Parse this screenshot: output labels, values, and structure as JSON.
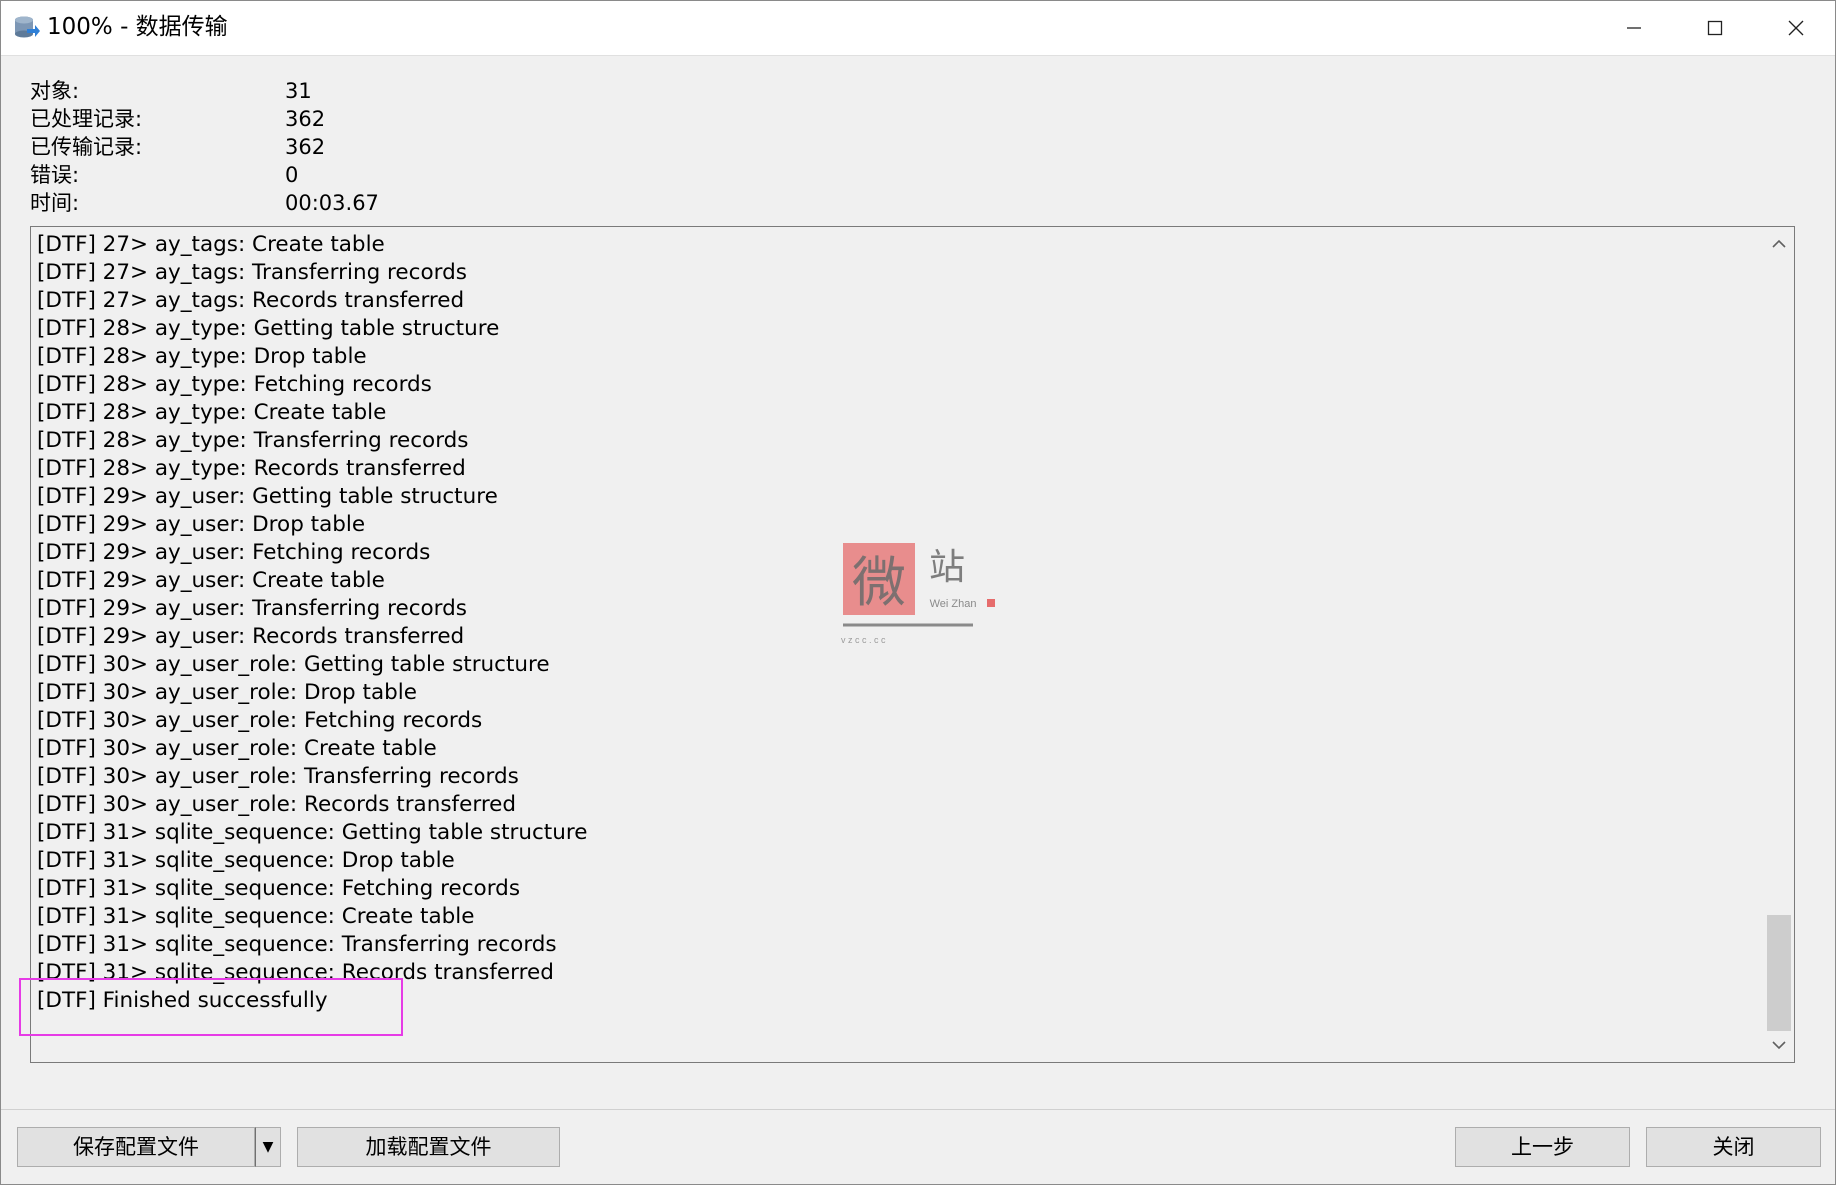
{
  "window": {
    "title": "100% - 数据传输",
    "controls": {
      "minimize": "—",
      "maximize": "☐",
      "close": "✕"
    }
  },
  "summary": [
    {
      "label": "对象:",
      "value": "31"
    },
    {
      "label": "已处理记录:",
      "value": "362"
    },
    {
      "label": "已传输记录:",
      "value": "362"
    },
    {
      "label": "错误:",
      "value": "0"
    },
    {
      "label": "时间:",
      "value": "00:03.67"
    }
  ],
  "log": [
    "[DTF] 27> ay_tags: Create table",
    "[DTF] 27> ay_tags: Transferring records",
    "[DTF] 27> ay_tags: Records transferred",
    "[DTF] 28> ay_type: Getting table structure",
    "[DTF] 28> ay_type: Drop table",
    "[DTF] 28> ay_type: Fetching records",
    "[DTF] 28> ay_type: Create table",
    "[DTF] 28> ay_type: Transferring records",
    "[DTF] 28> ay_type: Records transferred",
    "[DTF] 29> ay_user: Getting table structure",
    "[DTF] 29> ay_user: Drop table",
    "[DTF] 29> ay_user: Fetching records",
    "[DTF] 29> ay_user: Create table",
    "[DTF] 29> ay_user: Transferring records",
    "[DTF] 29> ay_user: Records transferred",
    "[DTF] 30> ay_user_role: Getting table structure",
    "[DTF] 30> ay_user_role: Drop table",
    "[DTF] 30> ay_user_role: Fetching records",
    "[DTF] 30> ay_user_role: Create table",
    "[DTF] 30> ay_user_role: Transferring records",
    "[DTF] 30> ay_user_role: Records transferred",
    "[DTF] 31> sqlite_sequence: Getting table structure",
    "[DTF] 31> sqlite_sequence: Drop table",
    "[DTF] 31> sqlite_sequence: Fetching records",
    "[DTF] 31> sqlite_sequence: Create table",
    "[DTF] 31> sqlite_sequence: Transferring records",
    "[DTF] 31> sqlite_sequence: Records transferred",
    "[DTF] Finished successfully"
  ],
  "scrollbar": {
    "up_icon": "chevron-up-icon",
    "down_icon": "chevron-down-icon"
  },
  "watermark": {
    "main": "微",
    "side": "站",
    "sub": "Wei Zhan",
    "domain": "v z c c . c c"
  },
  "buttons": {
    "save_config": "保存配置文件",
    "save_dropdown_icon": "▼",
    "load_config": "加载配置文件",
    "previous": "上一步",
    "close": "关闭"
  },
  "colors": {
    "highlight": "#e63be6",
    "watermark": "#e34b4b"
  }
}
